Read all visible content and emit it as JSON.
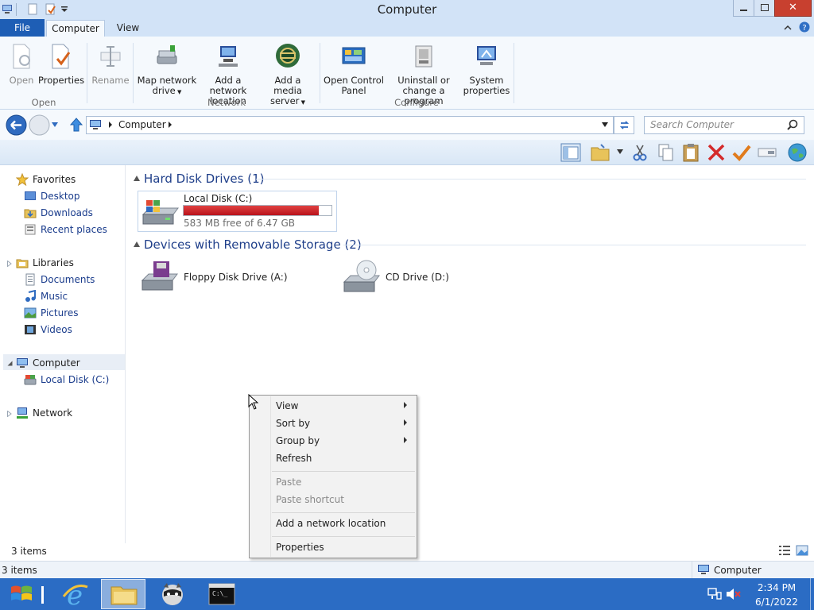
{
  "window": {
    "title": "Computer"
  },
  "ribbon": {
    "tabs": {
      "file": "File",
      "computer": "Computer",
      "view": "View"
    },
    "buttons": {
      "open": "Open",
      "properties": "Properties",
      "rename": "Rename",
      "map_network_drive_1": "Map network",
      "map_network_drive_2": "drive",
      "add_network_location_1": "Add a network",
      "add_network_location_2": "location",
      "add_media_server_1": "Add a media",
      "add_media_server_2": "server",
      "open_control_panel_1": "Open Control",
      "open_control_panel_2": "Panel",
      "uninstall_1": "Uninstall or",
      "uninstall_2": "change a program",
      "system_properties_1": "System",
      "system_properties_2": "properties"
    },
    "groups": {
      "open": "Open",
      "network": "Network",
      "configure": "Configure"
    }
  },
  "address": {
    "path": "Computer",
    "search_placeholder": "Search Computer"
  },
  "nav": {
    "favorites": "Favorites",
    "desktop": "Desktop",
    "downloads": "Downloads",
    "recent_places": "Recent places",
    "libraries": "Libraries",
    "documents": "Documents",
    "music": "Music",
    "pictures": "Pictures",
    "videos": "Videos",
    "computer": "Computer",
    "local_disk": "Local Disk (C:)",
    "network": "Network"
  },
  "content": {
    "hard_disk_header": "Hard Disk Drives (1)",
    "removable_header": "Devices with Removable Storage (2)",
    "drive_c": {
      "name": "Local Disk (C:)",
      "free_text": "583 MB free of 6.47 GB",
      "used_fraction": 0.912
    },
    "floppy": "Floppy Disk Drive (A:)",
    "cd": "CD Drive (D:)"
  },
  "context_menu": {
    "view": "View",
    "sort_by": "Sort by",
    "group_by": "Group by",
    "refresh": "Refresh",
    "paste": "Paste",
    "paste_shortcut": "Paste shortcut",
    "add_network_location": "Add a network location",
    "properties": "Properties"
  },
  "status": {
    "items_inner": "3 items",
    "items_bottom": "3 items",
    "location": "Computer"
  },
  "taskbar": {
    "time": "2:34 PM",
    "date": "6/1/2022"
  },
  "colors": {
    "accent": "#1e5eb5",
    "taskbar": "#2b6cc4",
    "drive_bar": "#c8101c",
    "close": "#c8402f"
  }
}
